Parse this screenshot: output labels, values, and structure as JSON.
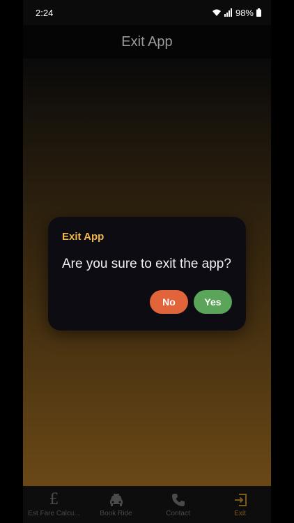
{
  "status_bar": {
    "time": "2:24",
    "battery": "98%",
    "icons": [
      "wifi-icon",
      "signal-icon",
      "battery-icon"
    ]
  },
  "app_bar": {
    "title": "Exit App"
  },
  "dialog": {
    "title": "Exit App",
    "message": "Are you sure to exit the app?",
    "no_label": "No",
    "yes_label": "Yes"
  },
  "bottom_nav": {
    "items": [
      {
        "label": "Est Fare Calcu...",
        "icon": "pound-icon",
        "active": false
      },
      {
        "label": "Book Ride",
        "icon": "car-icon",
        "active": false
      },
      {
        "label": "Contact",
        "icon": "phone-icon",
        "active": false
      },
      {
        "label": "Exit",
        "icon": "exit-icon",
        "active": true
      }
    ]
  },
  "colors": {
    "accent": "#f0b84a",
    "no_button": "#e2643a",
    "yes_button": "#5aa55a",
    "active_nav": "#7a5a1e",
    "inactive_nav": "#4a4a4a"
  }
}
